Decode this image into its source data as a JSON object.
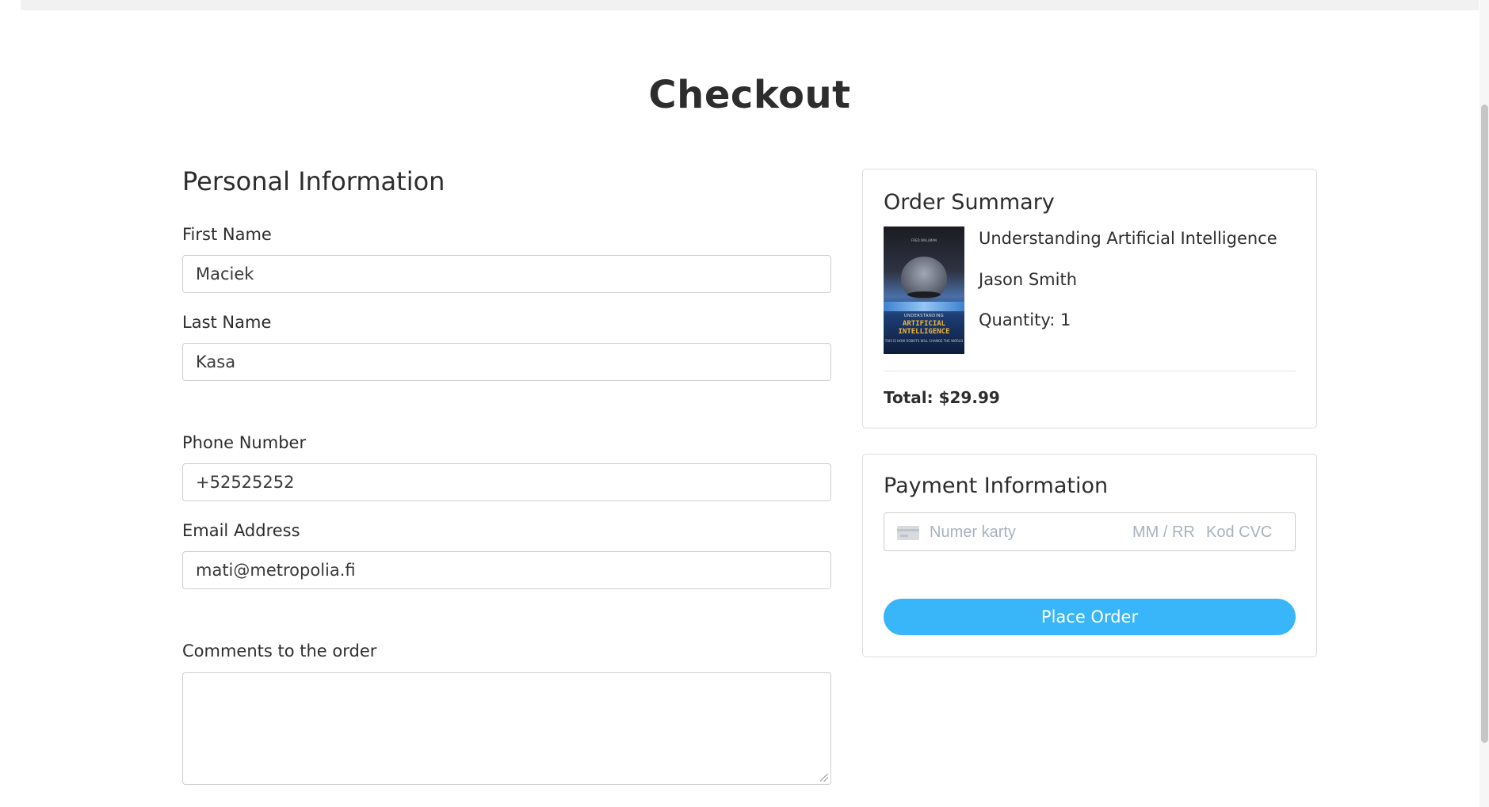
{
  "page": {
    "title": "Checkout"
  },
  "personal": {
    "section_title": "Personal Information",
    "first_name": {
      "label": "First Name",
      "value": "Maciek"
    },
    "last_name": {
      "label": "Last Name",
      "value": "Kasa"
    },
    "phone": {
      "label": "Phone Number",
      "value": "+52525252"
    },
    "email": {
      "label": "Email Address",
      "value": "mati@metropolia.fi"
    },
    "comments": {
      "label": "Comments to the order",
      "value": ""
    }
  },
  "order_summary": {
    "title": "Order Summary",
    "item": {
      "title": "Understanding Artificial Intelligence",
      "author": "Jason Smith",
      "quantity": "Quantity: 1",
      "cover": {
        "kicker": "UNDERSTANDING",
        "title": "ARTIFICIAL INTELLIGENCE",
        "subtitle": "THIS IS HOW ROBOTS WILL CHANGE THE WORLD",
        "author": "FRED WALLMAN"
      }
    },
    "total": "Total: $29.99"
  },
  "payment": {
    "title": "Payment Information",
    "card_number_placeholder": "Numer karty",
    "expiry_placeholder": "MM / RR",
    "cvc_placeholder": "Kod CVC",
    "place_order_label": "Place Order"
  },
  "colors": {
    "accent": "#38b6f9",
    "text": "#2d2d2d",
    "border": "#cfcfcf"
  }
}
